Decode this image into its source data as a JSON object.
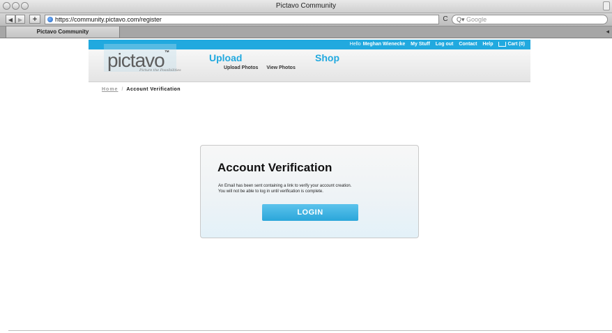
{
  "browser": {
    "window_title": "Pictavo Community",
    "back_label": "◀",
    "forward_label": "▶",
    "add_label": "+",
    "url": "https://community.pictavo.com/register",
    "reload_label": "C",
    "search_icon": "Q▾",
    "search_placeholder": "Google",
    "tab_label": "Pictavo Community"
  },
  "site": {
    "topbar": {
      "hello_prefix": "Hello",
      "user_name": "Meghan Wienecke",
      "links": [
        "My Stuff",
        "Log out",
        "Contact",
        "Help"
      ],
      "cart_label": "Cart (0)"
    },
    "logo": {
      "word": "pictavo",
      "tm": "™",
      "tagline": "Picture the Possibilities"
    },
    "nav": {
      "upload": "Upload",
      "upload_photos": "Upload Photos",
      "view_photos": "View Photos",
      "shop": "Shop"
    },
    "breadcrumb": {
      "home": "Home",
      "separator": "/",
      "current": "Account Verification"
    }
  },
  "verification": {
    "title": "Account Verification",
    "line1": "An Email has been sent containing a link to verify your account creation.",
    "line2": "You will not be able to log in until verification is complete.",
    "button_label": "LOGIN"
  },
  "colors": {
    "brand_blue": "#21a9df",
    "button_blue": "#2aa6da"
  }
}
